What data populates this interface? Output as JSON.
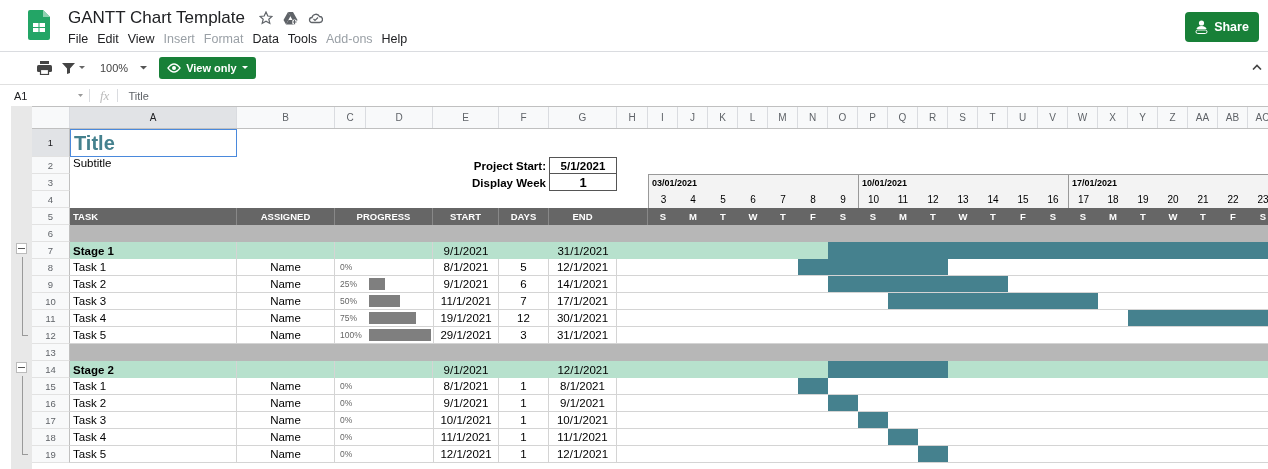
{
  "app": {
    "title": "GANTT Chart Template",
    "share_button": "Share",
    "menu": [
      {
        "label": "File",
        "disabled": false
      },
      {
        "label": "Edit",
        "disabled": false
      },
      {
        "label": "View",
        "disabled": false
      },
      {
        "label": "Insert",
        "disabled": true
      },
      {
        "label": "Format",
        "disabled": true
      },
      {
        "label": "Data",
        "disabled": false
      },
      {
        "label": "Tools",
        "disabled": false
      },
      {
        "label": "Add-ons",
        "disabled": true
      },
      {
        "label": "Help",
        "disabled": false
      }
    ]
  },
  "toolbar": {
    "zoom": "100%",
    "mode_button": "View only"
  },
  "formula_bar": {
    "cell_ref": "A1",
    "function_label": "fx",
    "content": "Title"
  },
  "sheet": {
    "columns": [
      {
        "label": "A",
        "selected": true
      },
      {
        "label": "B",
        "selected": false
      },
      {
        "label": "C",
        "selected": false
      },
      {
        "label": "D",
        "selected": false
      },
      {
        "label": "E",
        "selected": false
      },
      {
        "label": "F",
        "selected": false
      },
      {
        "label": "G",
        "selected": false
      },
      {
        "label": "H",
        "selected": false
      },
      {
        "label": "I",
        "selected": false
      },
      {
        "label": "J",
        "selected": false
      },
      {
        "label": "K",
        "selected": false
      },
      {
        "label": "L",
        "selected": false
      },
      {
        "label": "M",
        "selected": false
      },
      {
        "label": "N",
        "selected": false
      },
      {
        "label": "O",
        "selected": false
      },
      {
        "label": "P",
        "selected": false
      },
      {
        "label": "Q",
        "selected": false
      },
      {
        "label": "R",
        "selected": false
      },
      {
        "label": "S",
        "selected": false
      },
      {
        "label": "T",
        "selected": false
      },
      {
        "label": "U",
        "selected": false
      },
      {
        "label": "V",
        "selected": false
      },
      {
        "label": "W",
        "selected": false
      },
      {
        "label": "X",
        "selected": false
      },
      {
        "label": "Y",
        "selected": false
      },
      {
        "label": "Z",
        "selected": false
      },
      {
        "label": "AA",
        "selected": false
      },
      {
        "label": "AB",
        "selected": false
      },
      {
        "label": "AC",
        "selected": false
      }
    ],
    "rows": [
      {
        "number": "1",
        "kind": "title",
        "text": "Title",
        "selected": true
      },
      {
        "number": "2",
        "kind": "subtitle",
        "text": "Subtitle",
        "label": "Project Start:",
        "value": "5/1/2021"
      },
      {
        "number": "3",
        "kind": "setting",
        "label": "Display Week",
        "value": "1",
        "weeks": [
          "03/01/2021",
          "10/01/2021",
          "17/01/2021"
        ]
      },
      {
        "number": "4",
        "kind": "days",
        "days": [
          "3",
          "4",
          "5",
          "6",
          "7",
          "8",
          "9",
          "10",
          "11",
          "12",
          "13",
          "14",
          "15",
          "16",
          "17",
          "18",
          "19",
          "20",
          "21",
          "22",
          "23"
        ]
      },
      {
        "number": "5",
        "kind": "header",
        "headings": [
          "TASK",
          "ASSIGNED",
          "PROGRESS",
          "START",
          "DAYS",
          "END"
        ],
        "weekdays": [
          "S",
          "M",
          "T",
          "W",
          "T",
          "F",
          "S",
          "S",
          "M",
          "T",
          "W",
          "T",
          "F",
          "S",
          "S",
          "M",
          "T",
          "W",
          "T",
          "F",
          "S"
        ]
      },
      {
        "number": "6",
        "kind": "separator"
      },
      {
        "number": "7",
        "kind": "stage",
        "task": "Stage 1",
        "start": "9/1/2021",
        "end": "31/1/2021",
        "expanded": true,
        "timeline": [
          false,
          false,
          false,
          false,
          false,
          false,
          true,
          true,
          true,
          true,
          true,
          true,
          true,
          true,
          true,
          true,
          true,
          true,
          true,
          true,
          true
        ],
        "children": [
          {
            "number": "8",
            "task": "Task 1",
            "assigned": "Name",
            "progress": "0%",
            "start": "8/1/2021",
            "days": "5",
            "end": "12/1/2021",
            "timeline": [
              false,
              false,
              false,
              false,
              false,
              true,
              true,
              true,
              true,
              true,
              false,
              false,
              false,
              false,
              false,
              false,
              false,
              false,
              false,
              false,
              false
            ]
          },
          {
            "number": "9",
            "task": "Task 2",
            "assigned": "Name",
            "progress": "25%",
            "level": 0.25,
            "start": "9/1/2021",
            "days": "6",
            "end": "14/1/2021",
            "timeline": [
              false,
              false,
              false,
              false,
              false,
              false,
              true,
              true,
              true,
              true,
              true,
              true,
              false,
              false,
              false,
              false,
              false,
              false,
              false,
              false,
              false
            ]
          },
          {
            "number": "10",
            "task": "Task 3",
            "assigned": "Name",
            "progress": "50%",
            "level": 0.5,
            "start": "11/1/2021",
            "days": "7",
            "end": "17/1/2021",
            "timeline": [
              false,
              false,
              false,
              false,
              false,
              false,
              false,
              false,
              true,
              true,
              true,
              true,
              true,
              true,
              true,
              false,
              false,
              false,
              false,
              false,
              false
            ]
          },
          {
            "number": "11",
            "task": "Task 4",
            "assigned": "Name",
            "progress": "75%",
            "level": 0.75,
            "start": "19/1/2021",
            "days": "12",
            "end": "30/1/2021",
            "timeline": [
              false,
              false,
              false,
              false,
              false,
              false,
              false,
              false,
              false,
              false,
              false,
              false,
              false,
              false,
              false,
              false,
              true,
              true,
              true,
              true,
              true
            ]
          },
          {
            "number": "12",
            "task": "Task 5",
            "assigned": "Name",
            "progress": "100%",
            "level": 1,
            "start": "29/1/2021",
            "days": "3",
            "end": "31/1/2021",
            "timeline": [
              false,
              false,
              false,
              false,
              false,
              false,
              false,
              false,
              false,
              false,
              false,
              false,
              false,
              false,
              false,
              false,
              false,
              false,
              false,
              false,
              false
            ]
          }
        ]
      },
      {
        "number": "13",
        "kind": "separator"
      },
      {
        "number": "14",
        "kind": "stage",
        "task": "Stage 2",
        "start": "9/1/2021",
        "end": "12/1/2021",
        "expanded": true,
        "timeline": [
          false,
          false,
          false,
          false,
          false,
          false,
          true,
          true,
          true,
          true,
          false,
          false,
          false,
          false,
          false,
          false,
          false,
          false,
          false,
          false,
          false
        ],
        "children": [
          {
            "number": "15",
            "task": "Task 1",
            "assigned": "Name",
            "progress": "0%",
            "start": "8/1/2021",
            "days": "1",
            "end": "8/1/2021",
            "timeline": [
              false,
              false,
              false,
              false,
              false,
              true,
              false,
              false,
              false,
              false,
              false,
              false,
              false,
              false,
              false,
              false,
              false,
              false,
              false,
              false,
              false
            ]
          },
          {
            "number": "16",
            "task": "Task 2",
            "assigned": "Name",
            "progress": "0%",
            "start": "9/1/2021",
            "days": "1",
            "end": "9/1/2021",
            "timeline": [
              false,
              false,
              false,
              false,
              false,
              false,
              true,
              false,
              false,
              false,
              false,
              false,
              false,
              false,
              false,
              false,
              false,
              false,
              false,
              false,
              false
            ]
          },
          {
            "number": "17",
            "task": "Task 3",
            "assigned": "Name",
            "progress": "0%",
            "start": "10/1/2021",
            "days": "1",
            "end": "10/1/2021",
            "timeline": [
              false,
              false,
              false,
              false,
              false,
              false,
              false,
              true,
              false,
              false,
              false,
              false,
              false,
              false,
              false,
              false,
              false,
              false,
              false,
              false,
              false
            ]
          },
          {
            "number": "18",
            "task": "Task 4",
            "assigned": "Name",
            "progress": "0%",
            "start": "11/1/2021",
            "days": "1",
            "end": "11/1/2021",
            "timeline": [
              false,
              false,
              false,
              false,
              false,
              false,
              false,
              false,
              true,
              false,
              false,
              false,
              false,
              false,
              false,
              false,
              false,
              false,
              false,
              false,
              false
            ]
          },
          {
            "number": "19",
            "task": "Task 5",
            "assigned": "Name",
            "progress": "0%",
            "start": "12/1/2021",
            "days": "1",
            "end": "12/1/2021",
            "timeline": [
              false,
              false,
              false,
              false,
              false,
              false,
              false,
              false,
              false,
              true,
              false,
              false,
              false,
              false,
              false,
              false,
              false,
              false,
              false,
              false,
              false
            ]
          }
        ]
      }
    ]
  }
}
